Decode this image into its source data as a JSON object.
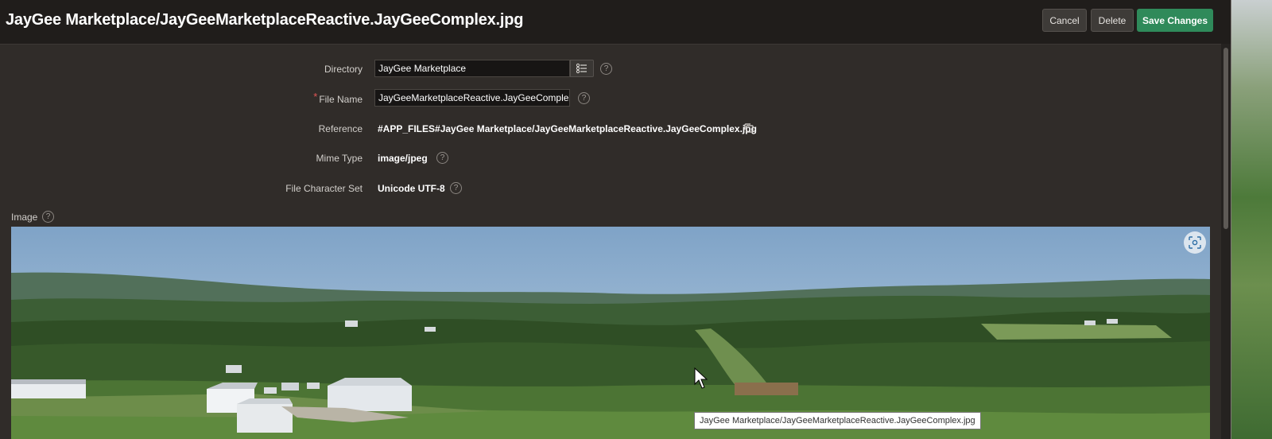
{
  "header": {
    "title": "JayGee Marketplace/JayGeeMarketplaceReactive.JayGeeComplex.jpg",
    "cancel_label": "Cancel",
    "delete_label": "Delete",
    "save_label": "Save Changes"
  },
  "form": {
    "directory": {
      "label": "Directory",
      "value": "JayGee Marketplace"
    },
    "file_name": {
      "label": "File Name",
      "required_mark": "*",
      "value": "JayGeeMarketplaceReactive.JayGeeComplex.jpg"
    },
    "reference": {
      "label": "Reference",
      "value": "#APP_FILES#JayGee Marketplace/JayGeeMarketplaceReactive.JayGeeComplex.jpg"
    },
    "mime_type": {
      "label": "Mime Type",
      "value": "image/jpeg"
    },
    "charset": {
      "label": "File Character Set",
      "value": "Unicode UTF-8"
    }
  },
  "image_section": {
    "label": "Image",
    "tooltip": "JayGee Marketplace/JayGeeMarketplaceReactive.JayGeeComplex.jpg"
  },
  "colors": {
    "background": "#302c29",
    "header": "#201d1b",
    "save_button": "#2f8a5a",
    "required": "#e25555"
  },
  "icons": {
    "help": "question-circle-icon",
    "list": "list-icon",
    "copy": "copy-icon",
    "zoom": "focus-zoom-icon",
    "cursor": "mouse-pointer-icon"
  }
}
